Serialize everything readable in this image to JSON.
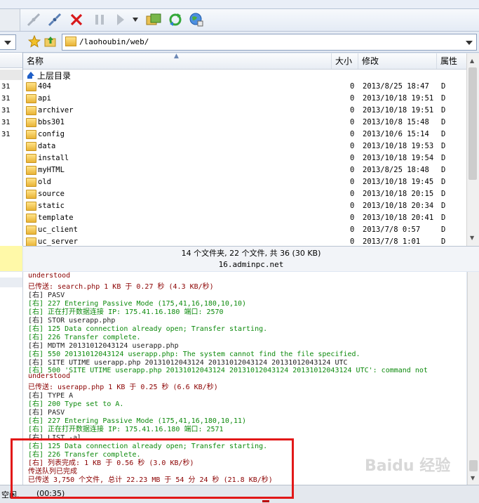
{
  "address": {
    "path": "/laohoubin/web/"
  },
  "left_pane": {
    "dates": [
      "31",
      "31",
      "31",
      "31",
      "31"
    ]
  },
  "columns": {
    "name": "名称",
    "size": "大小",
    "modified": "修改",
    "attr": "属性"
  },
  "parent_dir": "上层目录",
  "files": [
    {
      "name": "404",
      "size": "0",
      "modified": "2013/8/25 18:47",
      "attr": "D"
    },
    {
      "name": "api",
      "size": "0",
      "modified": "2013/10/18 19:51",
      "attr": "D"
    },
    {
      "name": "archiver",
      "size": "0",
      "modified": "2013/10/18 19:51",
      "attr": "D"
    },
    {
      "name": "bbs301",
      "size": "0",
      "modified": "2013/10/8 15:48",
      "attr": "D"
    },
    {
      "name": "config",
      "size": "0",
      "modified": "2013/10/6 15:14",
      "attr": "D"
    },
    {
      "name": "data",
      "size": "0",
      "modified": "2013/10/18 19:53",
      "attr": "D"
    },
    {
      "name": "install",
      "size": "0",
      "modified": "2013/10/18 19:54",
      "attr": "D"
    },
    {
      "name": "myHTML",
      "size": "0",
      "modified": "2013/8/25 18:48",
      "attr": "D"
    },
    {
      "name": "old",
      "size": "0",
      "modified": "2013/10/18 19:45",
      "attr": "D"
    },
    {
      "name": "source",
      "size": "0",
      "modified": "2013/10/18 20:15",
      "attr": "D"
    },
    {
      "name": "static",
      "size": "0",
      "modified": "2013/10/18 20:34",
      "attr": "D"
    },
    {
      "name": "template",
      "size": "0",
      "modified": "2013/10/18 20:41",
      "attr": "D"
    },
    {
      "name": "uc_client",
      "size": "0",
      "modified": "2013/7/8 0:57",
      "attr": "D"
    },
    {
      "name": "uc_server",
      "size": "0",
      "modified": "2013/7/8 1:01",
      "attr": "D"
    }
  ],
  "file_status": "14 个文件夹, 22 个文件, 共 36 (30 KB)",
  "server_name": "16.adminpc.net",
  "log": [
    {
      "text": "understood",
      "color": "d"
    },
    {
      "text": "已传送: search.php 1 KB 于 0.27 秒 (4.3 KB/秒)",
      "color": "d"
    },
    {
      "text": "[右] PASV",
      "color": "k"
    },
    {
      "text": "[右] 227 Entering Passive Mode (175,41,16,180,10,10)",
      "color": "g"
    },
    {
      "text": "[右] 正在打开数据连接 IP: 175.41.16.180 端口: 2570",
      "color": "g"
    },
    {
      "text": "[右] STOR userapp.php",
      "color": "k"
    },
    {
      "text": "[右] 125 Data connection already open; Transfer starting.",
      "color": "g"
    },
    {
      "text": "[右] 226 Transfer complete.",
      "color": "g"
    },
    {
      "text": "[右] MDTM 20131012043124 userapp.php",
      "color": "k"
    },
    {
      "text": "[右] 550 20131012043124 userapp.php: The system cannot find the file specified.",
      "color": "g"
    },
    {
      "text": "[右] SITE UTIME userapp.php 20131012043124 20131012043124 20131012043124 UTC",
      "color": "k"
    },
    {
      "text": "[右] 500 'SITE UTIME userapp.php 20131012043124 20131012043124 20131012043124 UTC': command not",
      "color": "g"
    },
    {
      "text": "understood",
      "color": "d"
    },
    {
      "text": "已传送: userapp.php 1 KB 于 0.25 秒 (6.6 KB/秒)",
      "color": "d"
    },
    {
      "text": "[右] TYPE A",
      "color": "k"
    },
    {
      "text": "[右] 200 Type set to A.",
      "color": "g"
    },
    {
      "text": "[右] PASV",
      "color": "k"
    },
    {
      "text": "[右] 227 Entering Passive Mode (175,41,16,180,10,11)",
      "color": "g"
    },
    {
      "text": "[右] 正在打开数据连接 IP: 175.41.16.180 端口: 2571",
      "color": "g"
    },
    {
      "text": "[右] LIST -al",
      "color": "k"
    },
    {
      "text": "[右] 125 Data connection already open; Transfer starting.",
      "color": "g"
    },
    {
      "text": "[右] 226 Transfer complete.",
      "color": "g"
    },
    {
      "text": "[右] 列表完成: 1 KB 于 0.56 秒 (3.0 KB/秒)",
      "color": "d"
    },
    {
      "text": "传送队列已完成",
      "color": "d"
    },
    {
      "text": "已传送 3,750 个文件, 总计 22.23 MB 于 54 分 24 秒 (21.8 KB/秒)",
      "color": "d"
    }
  ],
  "status_bar": {
    "state": "空闲.",
    "time": "(00:35)"
  },
  "watermark": "Baidu 经验",
  "colors": {
    "accent_red": "#e21818",
    "log_green": "#0d8a0d",
    "log_darkred": "#8b0000"
  }
}
